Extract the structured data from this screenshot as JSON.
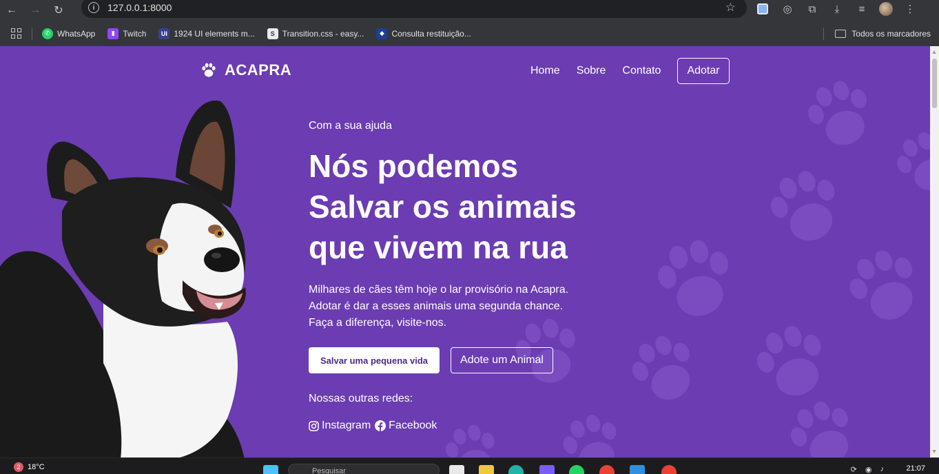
{
  "browser": {
    "url": "127.0.0.1:8000",
    "bookmarks": [
      {
        "label": "WhatsApp",
        "icon": "whatsapp-icon",
        "color": "#25d366"
      },
      {
        "label": "Twitch",
        "icon": "twitch-icon",
        "color": "#9146ff"
      },
      {
        "label": "1924 UI elements m...",
        "icon": "ui-icon",
        "color": "#3a3f8f"
      },
      {
        "label": "Transition.css - easy...",
        "icon": "transition-icon",
        "color": "#e8eaed"
      },
      {
        "label": "Consulta restituição...",
        "icon": "gov-icon",
        "color": "#1c3f94"
      }
    ],
    "all_bookmarks_label": "Todos os marcadores"
  },
  "site": {
    "brand": "ACAPRA",
    "nav": {
      "home": "Home",
      "about": "Sobre",
      "contact": "Contato",
      "cta": "Adotar"
    },
    "hero": {
      "eyebrow": "Com a sua ajuda",
      "title_line1": "Nós podemos",
      "title_line2": "Salvar os animais",
      "title_line3": "que vivem na rua",
      "description": "Milhares de cães têm hoje o lar provisório na Acapra. Adotar é dar a esses animais uma segunda chance. Faça a diferença, visite-nos.",
      "primary_button": "Salvar uma pequena vida",
      "secondary_button": "Adote um Animal",
      "socials_label": "Nossas outras redes:",
      "instagram": "Instagram",
      "facebook": "Facebook"
    },
    "colors": {
      "background": "#6b3cb2",
      "paw": "#7a4cc0",
      "primary_button_text": "#4b2a86"
    }
  },
  "taskbar": {
    "weather_badge": "2",
    "temperature": "18°C",
    "search_placeholder": "Pesquisar",
    "time": "21:07"
  }
}
